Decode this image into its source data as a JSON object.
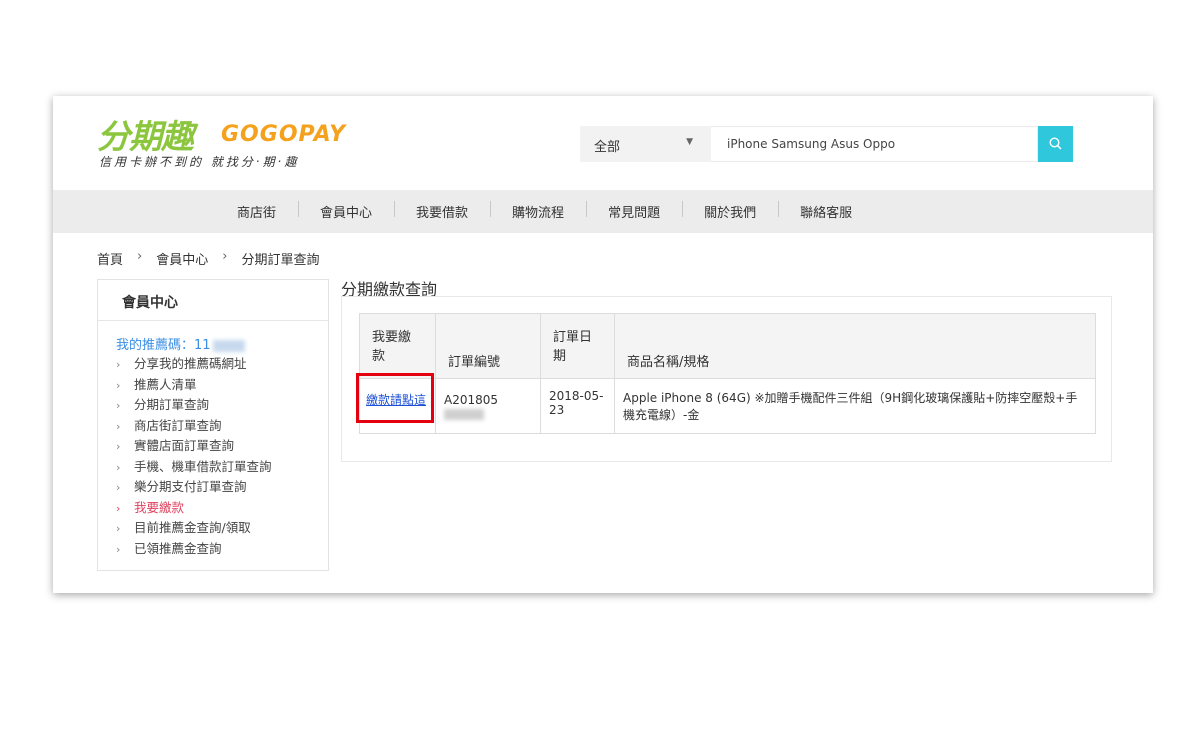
{
  "logo": {
    "chinese": "分期趣",
    "brand": "GOGOPAY",
    "tagline": "信用卡辦不到的 就找分‧期‧趣"
  },
  "search": {
    "category": "全部",
    "placeholder": "iPhone Samsung Asus Oppo",
    "icon": "search-icon"
  },
  "nav": [
    "商店街",
    "會員中心",
    "我要借款",
    "購物流程",
    "常見問題",
    "關於我們",
    "聯絡客服"
  ],
  "breadcrumb": [
    "首頁",
    "會員中心",
    "分期訂單查詢"
  ],
  "sidebar": {
    "title": "會員中心",
    "referral_label": "我的推薦碼：11",
    "items": [
      "分享我的推薦碼網址",
      "推薦人清單",
      "分期訂單查詢",
      "商店街訂單查詢",
      "實體店面訂單查詢",
      "手機、機車借款訂單查詢",
      "樂分期支付訂單查詢",
      "我要繳款",
      "目前推薦金查詢/領取",
      "已領推薦金查詢"
    ],
    "active_index": 7
  },
  "main": {
    "title": "分期繳款查詢",
    "table": {
      "headers": [
        "我要繳款",
        "訂單編號",
        "訂單日期",
        "商品名稱/規格"
      ],
      "rows": [
        {
          "pay_link": "繳款請點這",
          "order_no": "A201805",
          "date": "2018-05-23",
          "product": "Apple iPhone 8 (64G) ※加贈手機配件三件組（9H鋼化玻璃保護貼+防摔空壓殼+手機充電線）-金"
        }
      ]
    }
  },
  "colors": {
    "accent": "#2ec7dc",
    "logo_green": "#8cc63f",
    "logo_orange": "#f4a21d",
    "active_item": "#e0435f",
    "link": "#1a4fd6",
    "highlight_box": "#e5000f"
  }
}
